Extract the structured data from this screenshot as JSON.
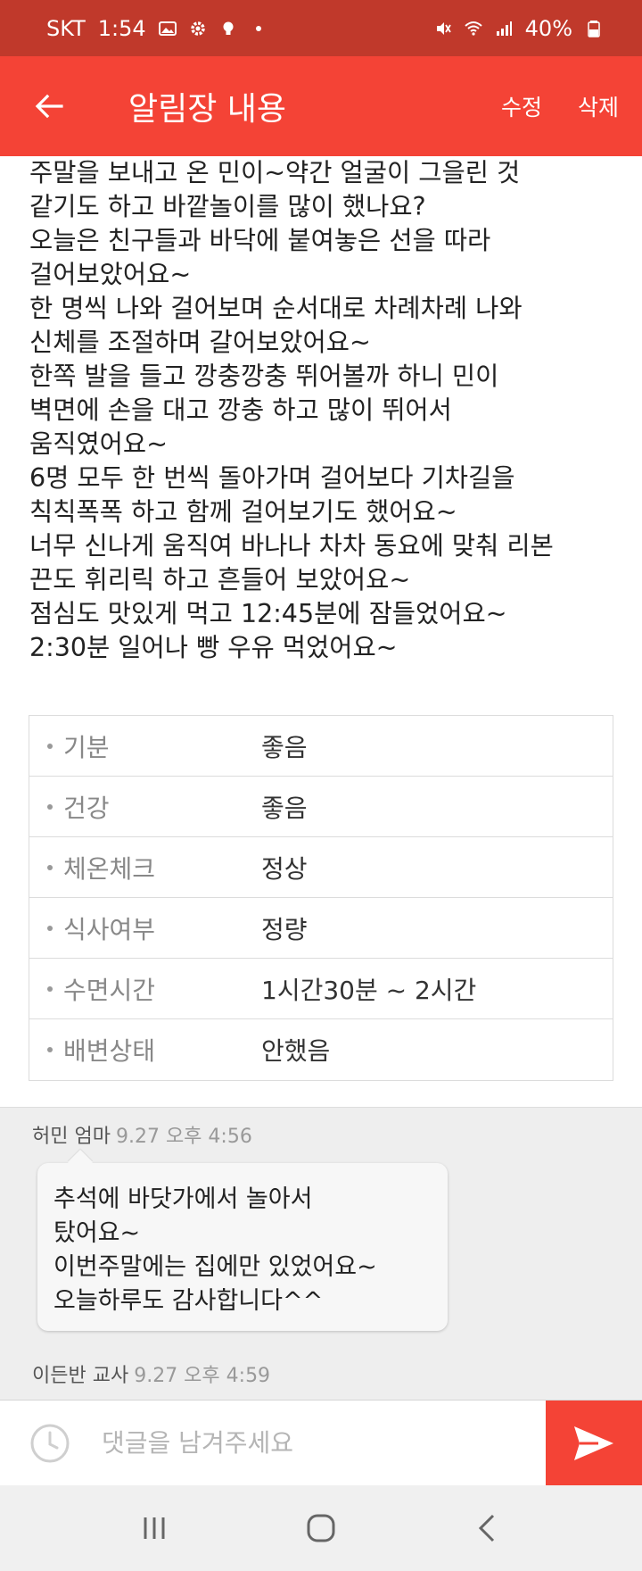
{
  "status_bar": {
    "carrier": "SKT",
    "time": "1:54",
    "battery": "40%",
    "icons_left": [
      "image-icon",
      "settings-icon",
      "bulb-icon",
      "dot-icon"
    ],
    "icons_right": [
      "mute-icon",
      "wifi-icon",
      "signal-icon",
      "battery-icon"
    ]
  },
  "app_bar": {
    "title": "알림장 내용",
    "edit_label": "수정",
    "delete_label": "삭제"
  },
  "notice": {
    "lines": [
      "주말을 보내고 온 민이~약간 얼굴이 그을린 것",
      "같기도 하고 바깥놀이를 많이 했나요?",
      "오늘은 친구들과 바닥에 붙여놓은 선을 따라",
      "걸어보았어요~",
      "한 명씩 나와 걸어보며 순서대로 차례차례 나와",
      "신체를 조절하며 갈어보았어요~",
      "한쪽 발을 들고 깡충깡충 뛰어볼까 하니 민이",
      "벽면에 손을 대고 깡충 하고 많이 뛰어서",
      "움직였어요~",
      "6명 모두 한 번씩 돌아가며 걸어보다 기차길을",
      "칙칙폭폭 하고 함께 걸어보기도 했어요~",
      "너무 신나게 움직여 바나나 차차 동요에  맞춰 리본",
      "끈도 휘리릭 하고 흔들어 보았어요~",
      "점심도 맛있게 먹고 12:45분에 잠들었어요~",
      "2:30분 일어나 빵 우유 먹었어요~"
    ]
  },
  "status_table": [
    {
      "label": "기분",
      "value": "좋음"
    },
    {
      "label": "건강",
      "value": "좋음"
    },
    {
      "label": "체온체크",
      "value": "정상"
    },
    {
      "label": "식사여부",
      "value": "정량"
    },
    {
      "label": "수면시간",
      "value": "1시간30분 ~ 2시간"
    },
    {
      "label": "배변상태",
      "value": "안했음"
    }
  ],
  "comments": [
    {
      "author": "허민 엄마",
      "time": "9.27 오후 4:56",
      "lines": [
        "추석에 바닷가에서 놀아서",
        "탔어요~",
        "이번주말에는 집에만 있었어요~",
        "오늘하루도 감사합니다^^"
      ]
    },
    {
      "author": "이든반 교사",
      "time": "9.27 오후 4:59"
    }
  ],
  "input": {
    "placeholder": "댓글을 남겨주세요"
  },
  "colors": {
    "status_bar": "#c0392b",
    "app_bar": "#f44336",
    "send_button": "#f44336"
  }
}
